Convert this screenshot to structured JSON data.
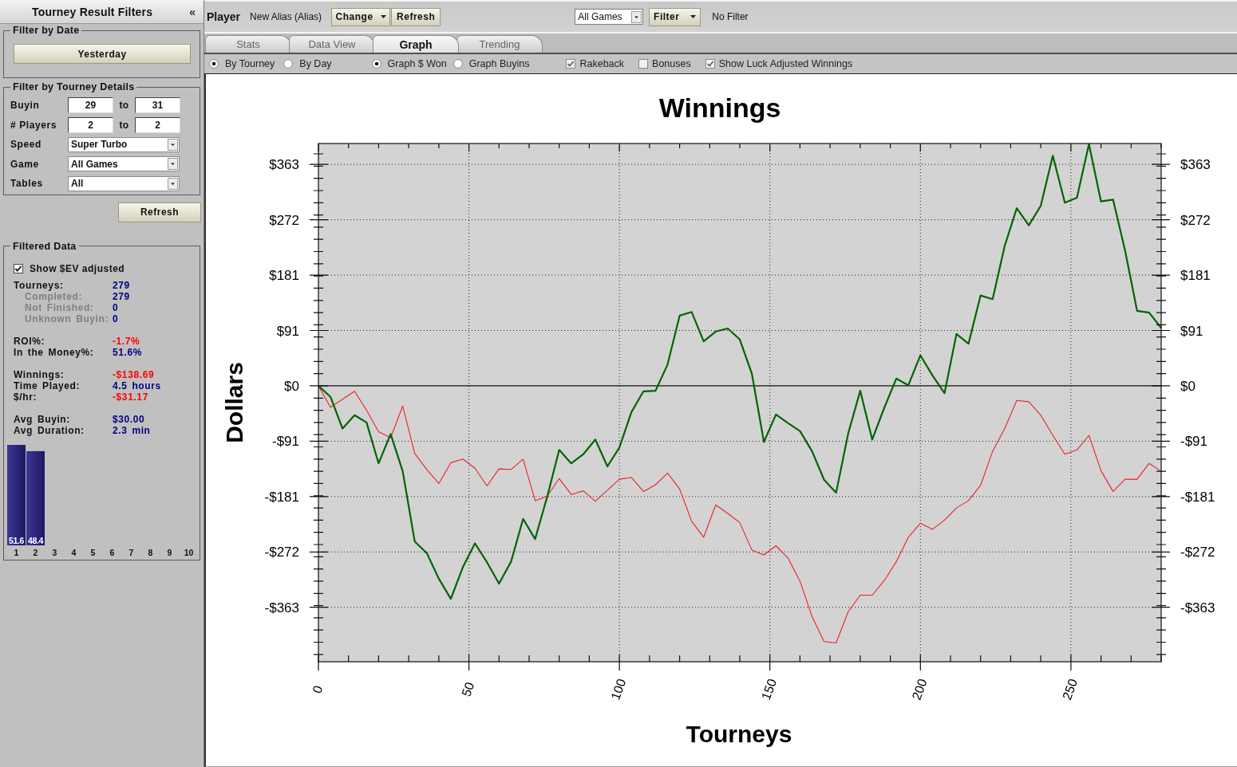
{
  "filters_panel": {
    "title": "Tourney Result Filters",
    "collapse_glyph": "«",
    "date_filter": {
      "title": "Filter by Date",
      "button": "Yesterday"
    },
    "details_filter": {
      "title": "Filter by Tourney Details",
      "ranges": [
        {
          "label": "Buyin",
          "from": "29",
          "to_label": "to",
          "to": "31"
        },
        {
          "label": "# Players",
          "from": "2",
          "to_label": "to",
          "to": "2"
        }
      ],
      "dropdowns": [
        {
          "label": "Speed",
          "value": "Super Turbo"
        },
        {
          "label": "Game",
          "value": "All Games"
        },
        {
          "label": "Tables",
          "value": "All"
        }
      ]
    },
    "refresh_button": "Refresh",
    "filtered_data": {
      "title": "Filtered Data",
      "ev_adjusted": {
        "label": "Show $EV adjusted",
        "checked": true
      },
      "stat_groups": [
        [
          {
            "label": "Tourneys:",
            "value": "279",
            "color": "#000080",
            "children": [
              {
                "label": "Completed:",
                "value": "279",
                "color": "#000080"
              },
              {
                "label": "Not Finished:",
                "value": "0",
                "color": "#000080"
              },
              {
                "label": "Unknown Buyin:",
                "value": "0",
                "color": "#000080"
              }
            ]
          }
        ],
        [
          {
            "label": "ROI%:",
            "value": "-1.7%",
            "color": "#ff0000"
          },
          {
            "label": "In the Money%:",
            "value": "51.6%",
            "color": "#000080"
          }
        ],
        [
          {
            "label": "Winnings:",
            "value": "-$138.69",
            "color": "#ff0000"
          },
          {
            "label": "Time Played:",
            "value": "4.5 hours",
            "color": "#000080"
          },
          {
            "label": "$/hr:",
            "value": "-$31.17",
            "color": "#ff0000"
          }
        ],
        [
          {
            "label": "Avg Buyin:",
            "value": "$30.00",
            "color": "#000080"
          },
          {
            "label": "Avg Duration:",
            "value": "2.3 min",
            "color": "#000080"
          }
        ]
      ],
      "chart_data": {
        "type": "bar",
        "categories": [
          "1",
          "2",
          "3",
          "4",
          "5",
          "6",
          "7",
          "8",
          "9",
          "10"
        ],
        "values": [
          51.6,
          48.4,
          0,
          0,
          0,
          0,
          0,
          0,
          0,
          0
        ],
        "value_labels": [
          "51.6",
          "48.4",
          null,
          null,
          null,
          null,
          null,
          null,
          null,
          null
        ]
      }
    }
  },
  "player_bar": {
    "label": "Player",
    "name": "New Alias (Alias)",
    "buttons": [
      {
        "label": "Change",
        "dropdown": true
      },
      {
        "label": "Refresh",
        "dropdown": false
      }
    ],
    "game_select": "All Games",
    "filter_button": {
      "label": "Filter",
      "dropdown": true
    },
    "filter_status": "No Filter"
  },
  "tabs": [
    {
      "label": "Stats",
      "selected": false
    },
    {
      "label": "Data View",
      "selected": false
    },
    {
      "label": "Graph",
      "selected": true
    },
    {
      "label": "Trending",
      "selected": false
    }
  ],
  "graph_options": {
    "group_by": [
      {
        "label": "By Tourney",
        "selected": true
      },
      {
        "label": "By Day",
        "selected": false
      }
    ],
    "graph_type": [
      {
        "label": "Graph $ Won",
        "selected": true
      },
      {
        "label": "Graph Buyins",
        "selected": false
      }
    ],
    "toggles": [
      {
        "label": "Rakeback",
        "checked": true
      },
      {
        "label": "Bonuses",
        "checked": false
      },
      {
        "label": "Show Luck Adjusted Winnings",
        "checked": true
      }
    ]
  },
  "graph": {
    "right_axis_labels": [
      "$363",
      "$272",
      "$181",
      "$91",
      "$0",
      "-$91",
      "-$181",
      "-$272",
      "-$363"
    ],
    "chart_data": {
      "type": "line",
      "title": "Winnings",
      "xlabel": "Tourneys",
      "ylabel": "Dollars",
      "x": [
        0,
        4,
        8,
        12,
        16,
        20,
        24,
        28,
        32,
        36,
        40,
        44,
        48,
        52,
        56,
        60,
        64,
        68,
        72,
        76,
        80,
        84,
        88,
        92,
        96,
        100,
        104,
        108,
        112,
        116,
        120,
        124,
        128,
        132,
        136,
        140,
        144,
        148,
        152,
        156,
        160,
        164,
        168,
        172,
        176,
        180,
        184,
        188,
        192,
        196,
        200,
        204,
        208,
        212,
        216,
        220,
        224,
        228,
        232,
        236,
        240,
        244,
        248,
        252,
        256,
        260,
        264,
        268,
        272,
        276,
        280
      ],
      "series": [
        {
          "color": "#ee2222",
          "values": [
            0,
            -35,
            -22,
            -9,
            -40,
            -75,
            -85,
            -33,
            -111,
            -137,
            -160,
            -126,
            -120,
            -135,
            -164,
            -136,
            -137,
            -120,
            -188,
            -181,
            -152,
            -178,
            -172,
            -189,
            -171,
            -153,
            -150,
            -173,
            -162,
            -143,
            -169,
            -222,
            -248,
            -195,
            -209,
            -224,
            -269,
            -277,
            -262,
            -282,
            -320,
            -378,
            -419,
            -421,
            -370,
            -343,
            -343,
            -319,
            -288,
            -248,
            -225,
            -235,
            -220,
            -200,
            -188,
            -163,
            -107,
            -70,
            -24,
            -26,
            -48,
            -81,
            -112,
            -105,
            -81,
            -139,
            -173,
            -153,
            -153,
            -127,
            -140
          ]
        },
        {
          "color": "#006400",
          "values": [
            0,
            -18,
            -70,
            -48,
            -60,
            -127,
            -79,
            -140,
            -255,
            -274,
            -316,
            -349,
            -297,
            -258,
            -289,
            -324,
            -288,
            -218,
            -251,
            -182,
            -105,
            -127,
            -112,
            -88,
            -132,
            -101,
            -43,
            -9,
            -8,
            35,
            115,
            121,
            73,
            89,
            94,
            76,
            20,
            -92,
            -47,
            -61,
            -74,
            -107,
            -154,
            -175,
            -78,
            -8,
            -88,
            -36,
            12,
            1,
            50,
            17,
            -12,
            85,
            69,
            148,
            142,
            229,
            291,
            263,
            295,
            377,
            300,
            308,
            396,
            302,
            305,
            222,
            123,
            120,
            95
          ]
        }
      ],
      "xlim": [
        0,
        280
      ],
      "ylim": [
        -452,
        397
      ],
      "xticks": [
        0,
        50,
        100,
        150,
        200,
        250
      ],
      "yticks": [
        {
          "value": 362.8,
          "label": "$363"
        },
        {
          "value": 272.1,
          "label": "$272"
        },
        {
          "value": 181.4,
          "label": "$181"
        },
        {
          "value": 90.7,
          "label": "$91"
        },
        {
          "value": 0,
          "label": "$0"
        },
        {
          "value": -90.7,
          "label": "-$91"
        },
        {
          "value": -181.4,
          "label": "-$181"
        },
        {
          "value": -272.1,
          "label": "-$272"
        },
        {
          "value": -362.8,
          "label": "-$363"
        }
      ],
      "grid": true
    }
  }
}
